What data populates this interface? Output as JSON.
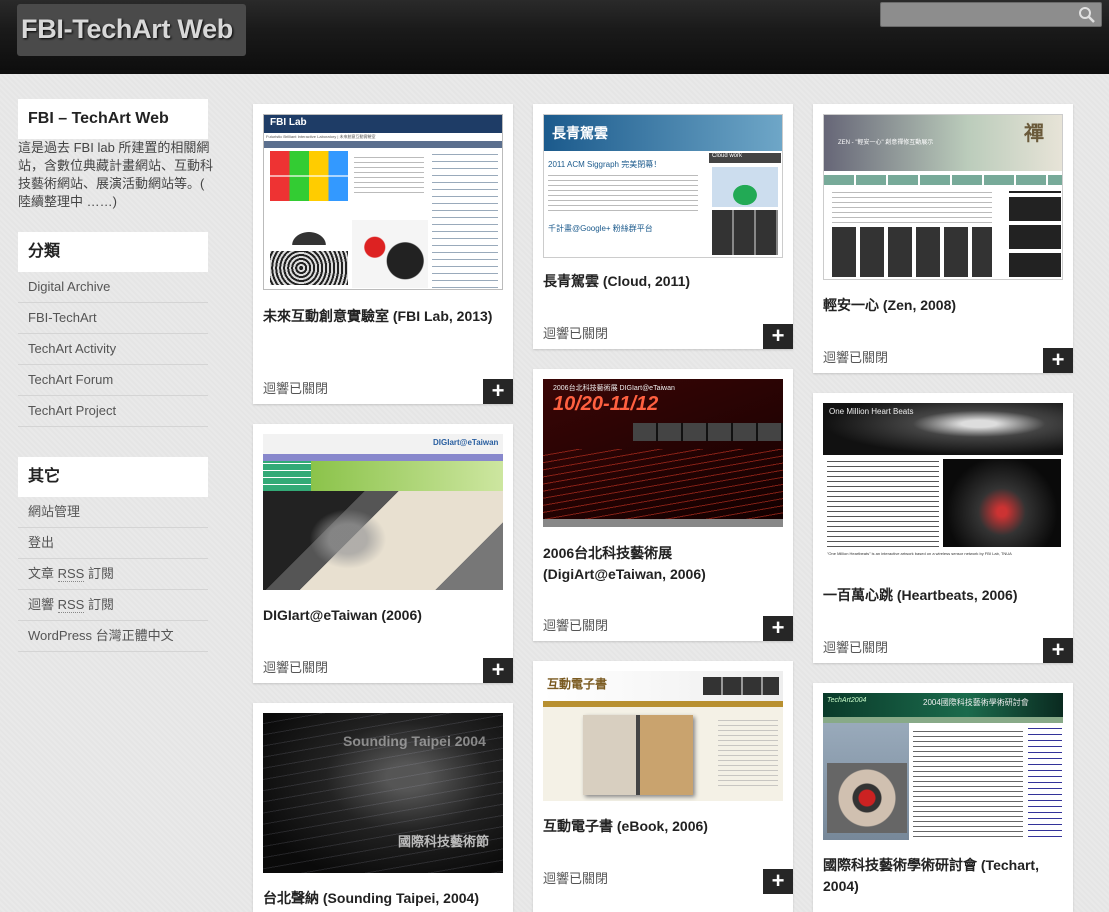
{
  "header": {
    "site_title": "FBI-TechArt Web",
    "search_placeholder": ""
  },
  "sidebar": {
    "about_title": "FBI – TechArt Web",
    "about_text": "這是過去 FBI lab 所建置的相關網站，含數位典藏計畫網站、互動科技藝術網站、展演活動網站等。( 陸續整理中 ……)",
    "categories_title": "分類",
    "categories": [
      "Digital Archive",
      "FBI-TechArt",
      "TechArt Activity",
      "TechArt Forum",
      "TechArt Project"
    ],
    "other_title": "其它",
    "other_items": {
      "admin": "網站管理",
      "logout": "登出",
      "entries_rss_pre": "文章 ",
      "entries_rss_rss": "RSS",
      "entries_rss_post": " 訂閱",
      "comments_rss_pre": "迴響 ",
      "comments_rss_rss": "RSS",
      "comments_rss_post": " 訂閱",
      "wordpress": "WordPress 台灣正體中文"
    }
  },
  "posts": [
    {
      "title": "未來互動創意實驗室 (FBI Lab, 2013)",
      "comments": "迴響已關閉",
      "more": "+"
    },
    {
      "title": "DIGIart@eTaiwan (2006)",
      "comments": "迴響已關閉",
      "more": "+"
    },
    {
      "title": "台北聲納 (Sounding Taipei, 2004)",
      "comments": "",
      "more": ""
    },
    {
      "title": "長青駕雲 (Cloud, 2011)",
      "comments": "迴響已關閉",
      "more": "+"
    },
    {
      "title": "2006台北科技藝術展 (DigiArt@eTaiwan, 2006)",
      "comments": "迴響已關閉",
      "more": "+"
    },
    {
      "title": "互動電子書 (eBook, 2006)",
      "comments": "迴響已關閉",
      "more": "+"
    },
    {
      "title": "輕安一心 (Zen, 2008)",
      "comments": "迴響已關閉",
      "more": "+"
    },
    {
      "title": "一百萬心跳 (Heartbeats, 2006)",
      "comments": "迴響已關閉",
      "more": "+"
    },
    {
      "title": "國際科技藝術學術研討會 (Techart, 2004)",
      "comments": "",
      "more": ""
    }
  ],
  "thumbs": {
    "fbilab": {
      "logo": "FBI Lab",
      "sub": "Futuristic Brilliant Interactive Laboratory | 未來創意互動實驗室"
    },
    "cloud": {
      "header": "長青駕雲",
      "post1": "2011 ACM Siggraph 完美閉幕！",
      "post2": "千計畫@Google+ 粉絲群平台",
      "side": "Cloud work"
    },
    "zen": {
      "brand": "禪",
      "tagline": "ZEN - \"輕安一心\" 創意禪修互動展示"
    },
    "digiart": {
      "top": "2006台北科技藝術展 DIGIart@eTaiwan",
      "dates": "10/20-11/12"
    },
    "heart": {
      "title": "One Million Heart Beats",
      "caption": "\"One Million Heartbeats\" is an interactive artwork based on a wireless sensor network by FBI Lab, TNUA"
    },
    "digiart06": {
      "logo": "DIGIart@eTaiwan"
    },
    "ebook": {
      "head": "互動電子書"
    },
    "sounding": {
      "big": "Sounding Taipei 2004",
      "sub": "國際科技藝術節"
    },
    "techart": {
      "banner": "2004國際科技藝術學術研討會",
      "logo": "TechArt2004"
    }
  }
}
